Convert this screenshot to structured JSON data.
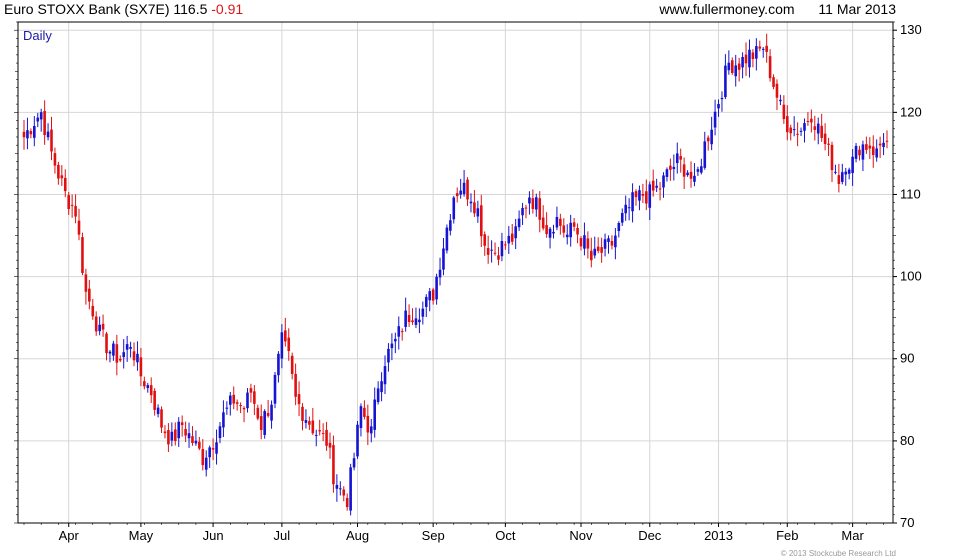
{
  "header": {
    "instrument": "Euro STOXX Bank (SX7E)",
    "price": "116.5",
    "change": "-0.91",
    "website": "www.fullermoney.com",
    "date": "11 Mar 2013"
  },
  "footer": {
    "copyright": "© 2013 Stockcube Research Ltd"
  },
  "chart_data": {
    "type": "candlestick",
    "period_label": "Daily",
    "colors": {
      "up": "#1414d2",
      "down": "#e01010",
      "grid": "#d6d6d6",
      "frame": "#000000",
      "period_label": "#1a1aa8"
    },
    "ylim": [
      70,
      131
    ],
    "ytick_labels": [
      "70",
      "80",
      "90",
      "100",
      "110",
      "120",
      "130"
    ],
    "grid": true,
    "xtick_labels": [
      "Apr",
      "May",
      "Jun",
      "Jul",
      "Aug",
      "Sep",
      "Oct",
      "Nov",
      "Dec",
      "2013",
      "Feb",
      "Mar"
    ],
    "xtick_session_index": [
      13,
      34,
      55,
      75,
      97,
      119,
      140,
      162,
      182,
      202,
      222,
      241
    ],
    "sessions": 252,
    "close_waypoints": [
      [
        0,
        117
      ],
      [
        3,
        119
      ],
      [
        5,
        120
      ],
      [
        8,
        115
      ],
      [
        12,
        110
      ],
      [
        15,
        108
      ],
      [
        18,
        98
      ],
      [
        20,
        96
      ],
      [
        22,
        93
      ],
      [
        25,
        91
      ],
      [
        28,
        90
      ],
      [
        31,
        92
      ],
      [
        34,
        88
      ],
      [
        37,
        86
      ],
      [
        40,
        82
      ],
      [
        43,
        80
      ],
      [
        46,
        82
      ],
      [
        49,
        80
      ],
      [
        52,
        78
      ],
      [
        55,
        80
      ],
      [
        58,
        83
      ],
      [
        61,
        85
      ],
      [
        64,
        84
      ],
      [
        66,
        86
      ],
      [
        69,
        82
      ],
      [
        72,
        85
      ],
      [
        75,
        92
      ],
      [
        77,
        90
      ],
      [
        79,
        85
      ],
      [
        82,
        83
      ],
      [
        85,
        81
      ],
      [
        88,
        80
      ],
      [
        90,
        76
      ],
      [
        92,
        74
      ],
      [
        94,
        73
      ],
      [
        96,
        78
      ],
      [
        98,
        84
      ],
      [
        101,
        81
      ],
      [
        103,
        87
      ],
      [
        105,
        90
      ],
      [
        108,
        92
      ],
      [
        111,
        95
      ],
      [
        114,
        96
      ],
      [
        116,
        96
      ],
      [
        119,
        98
      ],
      [
        121,
        102
      ],
      [
        123,
        106
      ],
      [
        125,
        110
      ],
      [
        127,
        111
      ],
      [
        130,
        110
      ],
      [
        132,
        108
      ],
      [
        134,
        104
      ],
      [
        137,
        103
      ],
      [
        140,
        104
      ],
      [
        143,
        105
      ],
      [
        145,
        108
      ],
      [
        147,
        110
      ],
      [
        150,
        108
      ],
      [
        152,
        106
      ],
      [
        155,
        107
      ],
      [
        158,
        105
      ],
      [
        160,
        106
      ],
      [
        163,
        104
      ],
      [
        165,
        102
      ],
      [
        168,
        103
      ],
      [
        171,
        104
      ],
      [
        174,
        107
      ],
      [
        177,
        109
      ],
      [
        180,
        110
      ],
      [
        182,
        110
      ],
      [
        185,
        111
      ],
      [
        188,
        113
      ],
      [
        190,
        114
      ],
      [
        193,
        113
      ],
      [
        195,
        111
      ],
      [
        198,
        116
      ],
      [
        201,
        120
      ],
      [
        203,
        123
      ],
      [
        205,
        126
      ],
      [
        208,
        126
      ],
      [
        211,
        127
      ],
      [
        213,
        127
      ],
      [
        215,
        128
      ],
      [
        217,
        125
      ],
      [
        219,
        122
      ],
      [
        221,
        119
      ],
      [
        224,
        118
      ],
      [
        226,
        118
      ],
      [
        229,
        120
      ],
      [
        231,
        118
      ],
      [
        233,
        116
      ],
      [
        235,
        114
      ],
      [
        237,
        112
      ],
      [
        239,
        114
      ],
      [
        241,
        114
      ],
      [
        243,
        116
      ],
      [
        246,
        116
      ],
      [
        248,
        115
      ],
      [
        250,
        117
      ],
      [
        251,
        116.5
      ]
    ]
  }
}
